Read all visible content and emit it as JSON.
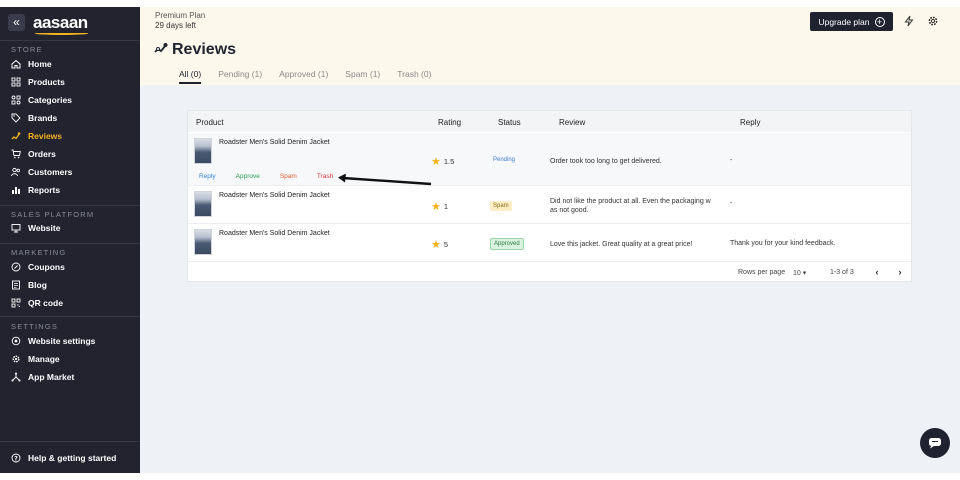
{
  "app": {
    "logo_text": "aasaan"
  },
  "sidebar": {
    "sections": {
      "store": "STORE",
      "sales_platform": "SALES PLATFORM",
      "marketing": "MARKETING",
      "settings": "SETTINGS"
    },
    "items": [
      {
        "label": "Home",
        "icon": "home-icon"
      },
      {
        "label": "Products",
        "icon": "grid-icon"
      },
      {
        "label": "Categories",
        "icon": "categories-icon"
      },
      {
        "label": "Brands",
        "icon": "tag-icon"
      },
      {
        "label": "Reviews",
        "icon": "reviews-icon",
        "active": true
      },
      {
        "label": "Orders",
        "icon": "cart-icon"
      },
      {
        "label": "Customers",
        "icon": "users-icon"
      },
      {
        "label": "Reports",
        "icon": "bar-chart-icon"
      },
      {
        "label": "Website",
        "icon": "monitor-icon"
      },
      {
        "label": "Coupons",
        "icon": "coupon-icon"
      },
      {
        "label": "Blog",
        "icon": "blog-icon"
      },
      {
        "label": "QR code",
        "icon": "qr-icon"
      },
      {
        "label": "Website settings",
        "icon": "settings-icon"
      },
      {
        "label": "Manage",
        "icon": "gear-icon"
      },
      {
        "label": "App Market",
        "icon": "apps-icon"
      }
    ],
    "help": "Help & getting started"
  },
  "header": {
    "plan_name": "Premium Plan",
    "plan_days": "29 days left",
    "upgrade_label": "Upgrade plan",
    "title": "Reviews"
  },
  "tabs": [
    {
      "label": "All (0)",
      "active": true
    },
    {
      "label": "Pending (1)"
    },
    {
      "label": "Approved (1)"
    },
    {
      "label": "Spam (1)"
    },
    {
      "label": "Trash (0)"
    }
  ],
  "table": {
    "columns": [
      "Product",
      "Rating",
      "Status",
      "Review",
      "Reply"
    ],
    "rows": [
      {
        "product": "Roadster Men's Solid Denim Jacket",
        "rating": "1.5",
        "status": "Pending",
        "review": "Order took too long to get delivered.",
        "reply": "-"
      },
      {
        "product": "Roadster Men's Solid Denim Jacket",
        "rating": "1",
        "status": "Spam",
        "review": "Did not like the product at all. Even the packaging was not good.",
        "review_line1": "Did not like the product at all. Even the packaging w",
        "review_line2": "as not good.",
        "reply": "-"
      },
      {
        "product": "Roadster Men's Solid Denim Jacket",
        "rating": "5",
        "status": "Approved",
        "review": "Love this jacket. Great quality at a great price!",
        "reply": "Thank you for your kind feedback."
      }
    ],
    "row_actions": {
      "reply": "Reply",
      "approve": "Approve",
      "spam": "Spam",
      "trash": "Trash"
    },
    "footer": {
      "rows_per_page_label": "Rows per page",
      "rows_per_page_value": "10",
      "range": "1-3 of 3"
    }
  },
  "colors": {
    "sidebar_bg": "#22232f",
    "accent": "#f5b21e",
    "topbar_bg": "#fdf8ec",
    "main_bg": "#eef1f5"
  }
}
